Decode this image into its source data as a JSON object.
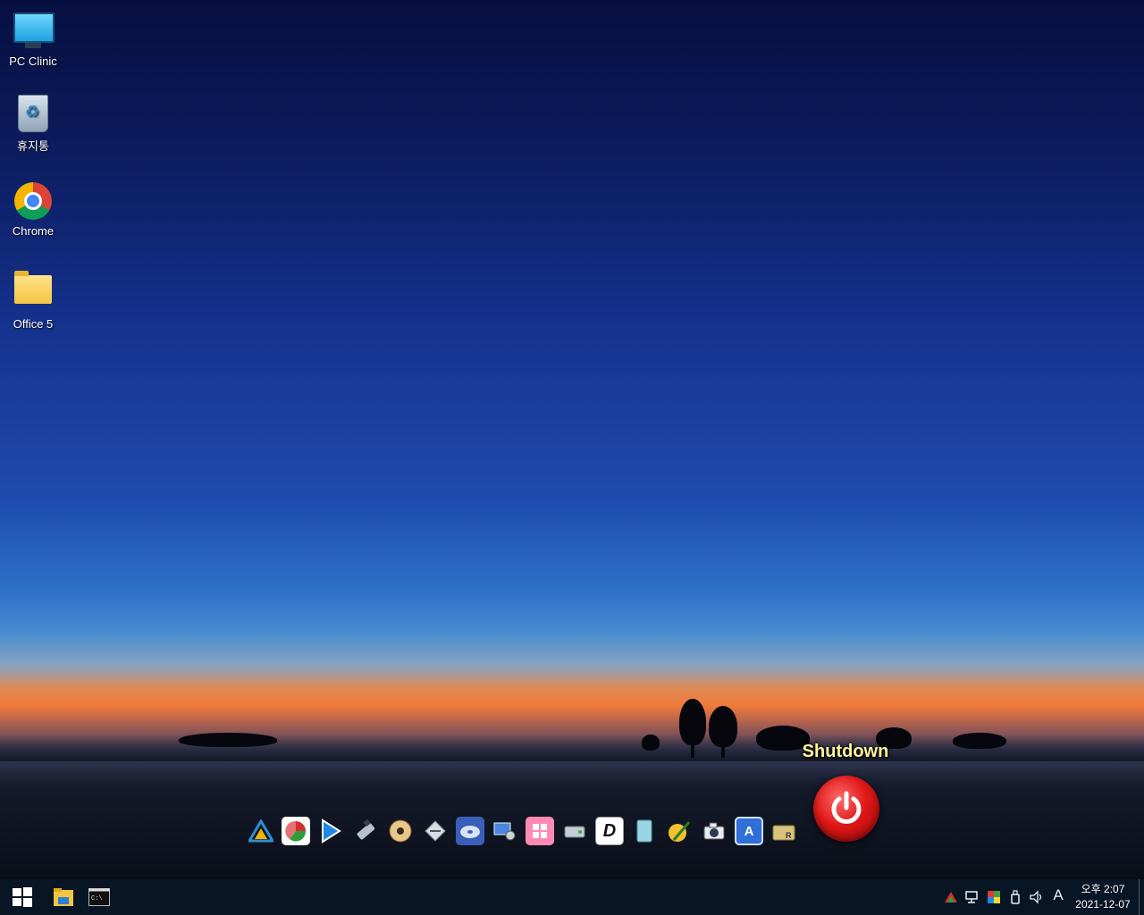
{
  "desktop": {
    "icons": [
      {
        "label": "PC Clinic",
        "icon": "monitor-icon"
      },
      {
        "label": "휴지통",
        "icon": "recycle-bin-icon"
      },
      {
        "label": "Chrome",
        "icon": "chrome-icon"
      },
      {
        "label": "Office 5",
        "icon": "folder-icon"
      }
    ]
  },
  "dock": {
    "items": [
      {
        "icon": "triangle-app-icon",
        "color": "#2d8fd6"
      },
      {
        "icon": "pie-chart-app-icon",
        "color": "#ffffff"
      },
      {
        "icon": "play-icon",
        "color": "#1e88e5"
      },
      {
        "icon": "usb-drive-icon",
        "color": "#9aa6b2"
      },
      {
        "icon": "disc-icon",
        "color": "#d8a05a"
      },
      {
        "icon": "diamond-tool-icon",
        "color": "#cfd6dd"
      },
      {
        "icon": "disk-image-icon",
        "color": "#4a6fd0"
      },
      {
        "icon": "computer-settings-icon",
        "color": "#3b7bd8"
      },
      {
        "icon": "windows-tiles-icon",
        "color": "#ff7aa8"
      },
      {
        "icon": "hard-drive-icon",
        "color": "#b8c2cc"
      },
      {
        "icon": "d-letter-app-icon",
        "color": "#ffffff"
      },
      {
        "icon": "notepad-icon",
        "color": "#8fd0dd"
      },
      {
        "icon": "color-picker-icon",
        "color": "#f2c030"
      },
      {
        "icon": "screenshot-camera-icon",
        "color": "#e0e6ee"
      },
      {
        "icon": "a-letter-app-icon",
        "color": "#2f6fd6"
      },
      {
        "icon": "folder-r-icon",
        "color": "#d9c27a"
      }
    ],
    "shutdown_label": "Shutdown"
  },
  "taskbar": {
    "start_icon": "windows-logo-icon",
    "pinned": [
      {
        "icon": "file-explorer-icon"
      },
      {
        "icon": "command-prompt-icon"
      }
    ],
    "tray": [
      {
        "icon": "tray-app-icon"
      },
      {
        "icon": "network-icon"
      },
      {
        "icon": "color-palette-icon"
      },
      {
        "icon": "usb-eject-icon"
      },
      {
        "icon": "volume-icon"
      }
    ],
    "ime_label": "A",
    "time": "오후 2:07",
    "date": "2021-12-07"
  }
}
